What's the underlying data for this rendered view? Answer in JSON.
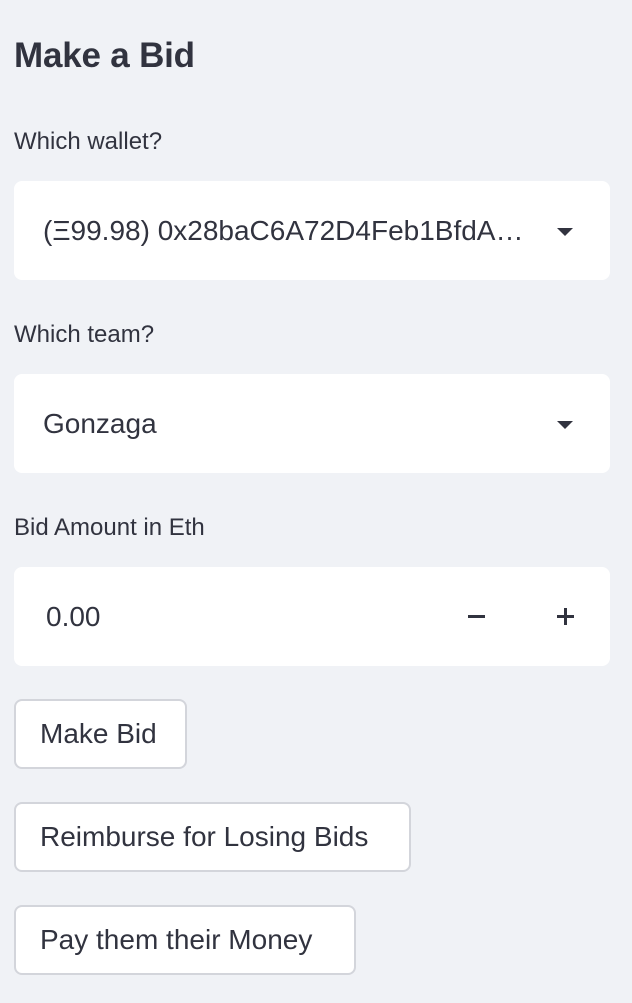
{
  "form": {
    "title": "Make a Bid",
    "wallet": {
      "label": "Which wallet?",
      "value": "(Ξ99.98) 0x28baC6A72D4Feb1BfdA…"
    },
    "team": {
      "label": "Which team?",
      "value": "Gonzaga"
    },
    "bid_amount": {
      "label": "Bid Amount in Eth",
      "value": "0.00",
      "decrement_icon": "minus-icon",
      "increment_icon": "plus-icon"
    },
    "buttons": {
      "make_bid": "Make Bid",
      "reimburse": "Reimburse for Losing Bids",
      "pay": "Pay them their Money"
    }
  }
}
